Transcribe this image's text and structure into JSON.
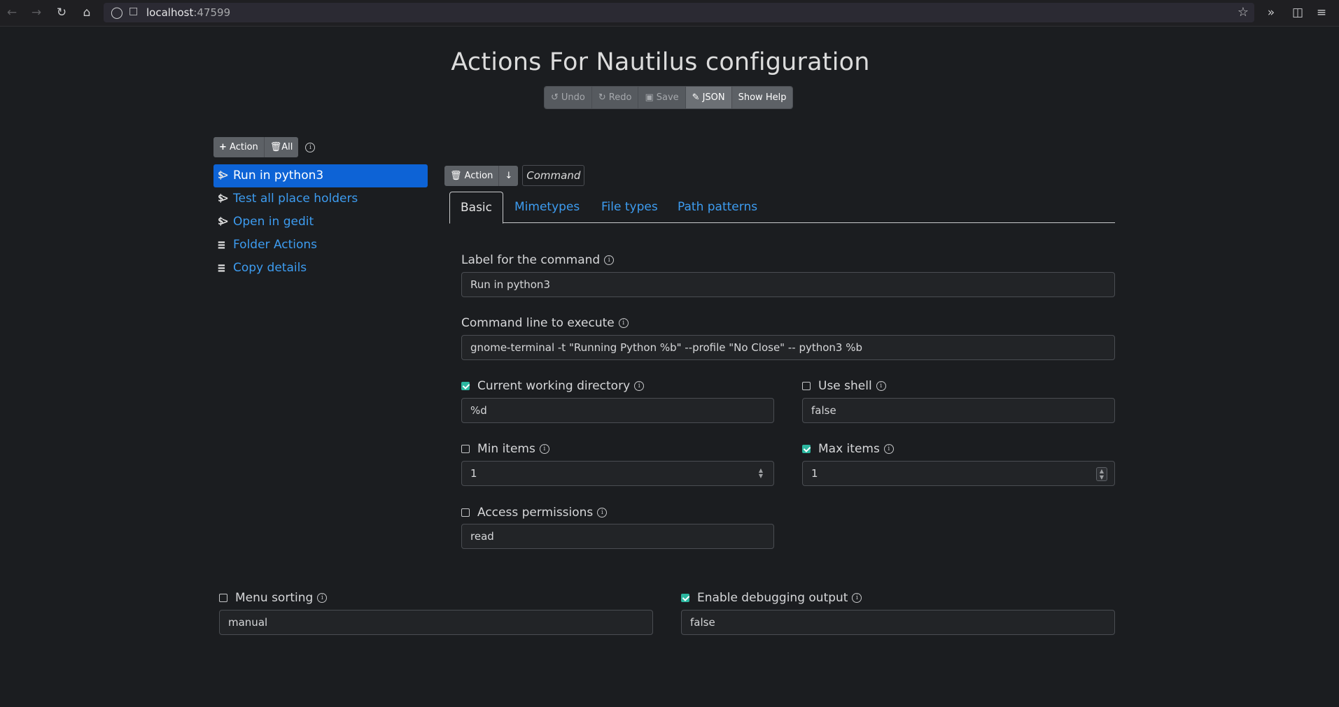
{
  "browser": {
    "url_host": "localhost",
    "url_port": ":47599"
  },
  "page": {
    "title": "Actions For Nautilus configuration"
  },
  "toolbar": {
    "undo_label": "Undo",
    "redo_label": "Redo",
    "save_label": "Save",
    "json_label": "JSON",
    "help_label": "Show Help"
  },
  "left": {
    "add_action_label": "Action",
    "delete_all_label": "All",
    "actions": [
      {
        "label": "Run in python3",
        "icon": "command",
        "selected": true
      },
      {
        "label": "Test all place holders",
        "icon": "command",
        "selected": false
      },
      {
        "label": "Open in gedit",
        "icon": "command",
        "selected": false
      },
      {
        "label": "Folder Actions",
        "icon": "menu",
        "selected": false
      },
      {
        "label": "Copy details",
        "icon": "menu",
        "selected": false
      }
    ]
  },
  "editor": {
    "delete_action_label": "Action",
    "type_badge": "Command",
    "tabs": [
      "Basic",
      "Mimetypes",
      "File types",
      "Path patterns"
    ],
    "active_tab": "Basic",
    "fields": {
      "label": {
        "label": "Label for the command",
        "value": "Run in python3"
      },
      "command": {
        "label": "Command line to execute",
        "value": "gnome-terminal -t \"Running Python %b\" --profile \"No Close\" -- python3 %b"
      },
      "cwd": {
        "label": "Current working directory",
        "value": "%d",
        "checked": true
      },
      "use_shell": {
        "label": "Use shell",
        "value": "false",
        "checked": false
      },
      "min_items": {
        "label": "Min items",
        "value": "1",
        "checked": false
      },
      "max_items": {
        "label": "Max items",
        "value": "1",
        "checked": true
      },
      "permissions": {
        "label": "Access permissions",
        "value": "read",
        "checked": false
      }
    }
  },
  "global": {
    "menu_sorting": {
      "label": "Menu sorting",
      "value": "manual",
      "checked": false
    },
    "debug": {
      "label": "Enable debugging output",
      "value": "false",
      "checked": true
    }
  },
  "colors": {
    "background": "#1b1d20",
    "link": "#3d9cf0",
    "selected": "#0d63d6",
    "checkbox": "#2bb7a0"
  }
}
